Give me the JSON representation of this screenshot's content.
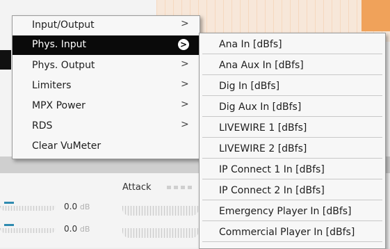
{
  "background": {
    "attack_label": "Attack",
    "meters": [
      {
        "value": "0.0",
        "unit": "dB"
      },
      {
        "value": "0.0",
        "unit": "dB"
      }
    ]
  },
  "menu": {
    "items": [
      {
        "label": "Input/Output",
        "has_submenu": true,
        "selected": false
      },
      {
        "label": "Phys. Input",
        "has_submenu": true,
        "selected": true
      },
      {
        "label": "Phys. Output",
        "has_submenu": true,
        "selected": false
      },
      {
        "label": "Limiters",
        "has_submenu": true,
        "selected": false
      },
      {
        "label": "MPX Power",
        "has_submenu": true,
        "selected": false
      },
      {
        "label": "RDS",
        "has_submenu": true,
        "selected": false
      },
      {
        "label": "Clear VuMeter",
        "has_submenu": false,
        "selected": false
      }
    ],
    "submenu_arrow": ">"
  },
  "submenu": {
    "items": [
      "Ana In [dBfs]",
      "Ana Aux In [dBfs]",
      "Dig In [dBfs]",
      "Dig Aux In [dBfs]",
      "LIVEWIRE 1 [dBfs]",
      "LIVEWIRE 2 [dBfs]",
      "IP Connect 1 In [dBfs]",
      "IP Connect 2 In [dBfs]",
      "Emergency Player In [dBfs]",
      "Commercial Player In [dBfs]"
    ]
  },
  "colors": {
    "selected_bg": "#0a0a0a",
    "selected_text": "#ffffff",
    "menu_bg": "#f7f7f7",
    "accent_orange": "#f0a25a"
  }
}
